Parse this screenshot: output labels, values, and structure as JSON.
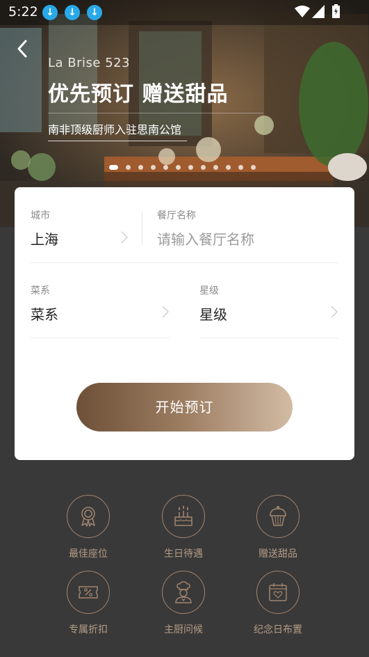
{
  "status_bar": {
    "time": "5:22",
    "notification_icons": [
      "download-icon",
      "download-icon",
      "download-icon"
    ],
    "system_icons": [
      "wifi-icon",
      "signal-icon",
      "battery-charging-icon"
    ]
  },
  "hero": {
    "brand": "La Brise 523",
    "headline": "优先预订 赠送甜品",
    "subline": "南非顶级厨师入驻思南公馆",
    "carousel_pages": 12,
    "carousel_active": 1
  },
  "form": {
    "city": {
      "label": "城市",
      "value": "上海"
    },
    "restaurant": {
      "label": "餐厅名称",
      "placeholder": "请输入餐厅名称"
    },
    "cuisine": {
      "label": "菜系",
      "value": "菜系"
    },
    "rating": {
      "label": "星级",
      "value": "星级"
    },
    "submit_label": "开始预订"
  },
  "perks": [
    {
      "label": "最佳座位",
      "icon": "medal-icon"
    },
    {
      "label": "生日待遇",
      "icon": "birthday-cake-icon"
    },
    {
      "label": "赠送甜品",
      "icon": "cupcake-icon"
    },
    {
      "label": "专属折扣",
      "icon": "discount-coupon-icon"
    },
    {
      "label": "主厨问候",
      "icon": "chef-icon"
    },
    {
      "label": "纪念日布置",
      "icon": "calendar-heart-icon"
    }
  ],
  "colors": {
    "accent_gold": "#a08670",
    "cta_dark": "#6d5037",
    "cta_light": "#d2bba4",
    "background": "#3a3939",
    "download_badge": "#29a9e9"
  }
}
